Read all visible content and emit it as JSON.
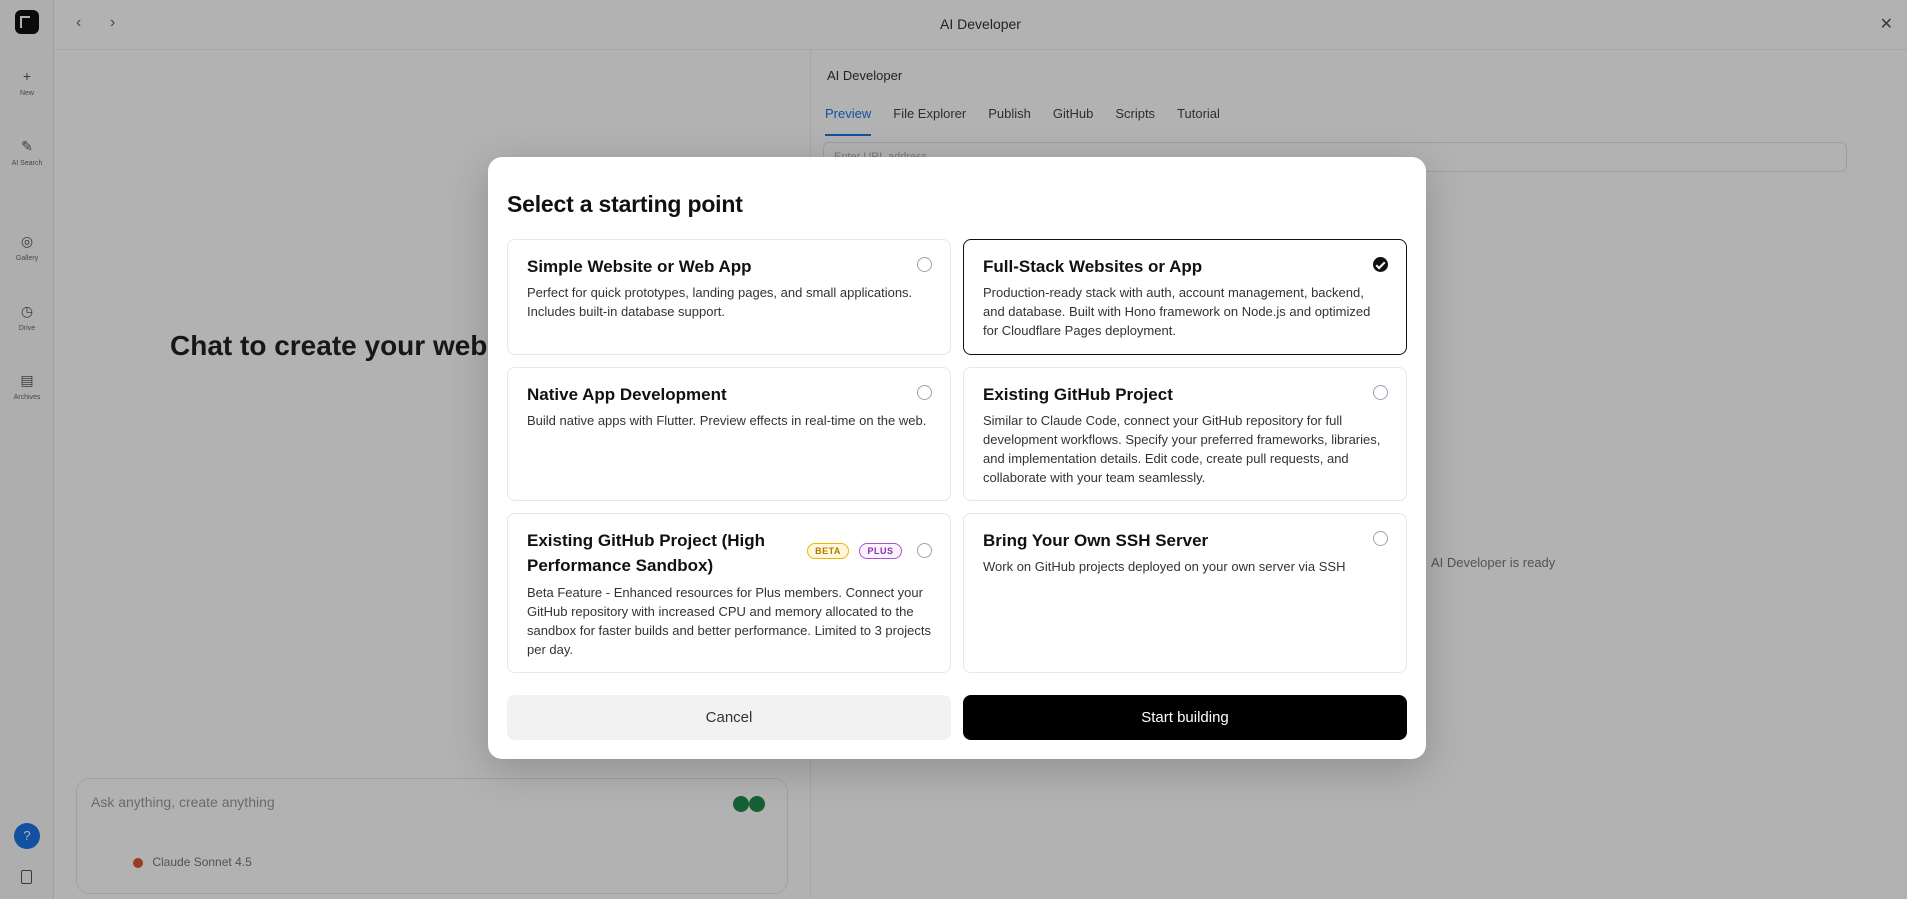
{
  "app": {
    "title": "AI Developer",
    "sidebar": [
      {
        "label": "New",
        "icon": "plus-icon"
      },
      {
        "label": "AI Search",
        "icon": "edit-icon"
      },
      {
        "label": "Gallery",
        "icon": "compass-icon"
      },
      {
        "label": "Drive",
        "icon": "clock-icon"
      },
      {
        "label": "Archives",
        "icon": "archive-icon"
      }
    ],
    "help_label": "?",
    "chat_heading": "Chat to create your website",
    "chat_placeholder": "Ask anything, create anything",
    "model_name": "Claude Sonnet 4.5",
    "panel_title": "AI Developer",
    "panel_tabs": [
      "Preview",
      "File Explorer",
      "Publish",
      "GitHub",
      "Scripts",
      "Tutorial"
    ],
    "panel_input_placeholder": "Enter URL address",
    "panel_status": "AI Developer is ready"
  },
  "modal": {
    "title": "Select a starting point",
    "options": [
      {
        "title": "Simple Website or Web App",
        "description": "Perfect for quick prototypes, landing pages, and small applications. Includes built-in database support.",
        "selected": false
      },
      {
        "title": "Full-Stack Websites or App",
        "description": "Production-ready stack with auth, account management, backend, and database. Built with Hono framework on Node.js and optimized for Cloudflare Pages deployment.",
        "selected": true
      },
      {
        "title": "Native App Development",
        "description": "Build native apps with Flutter. Preview effects in real-time on the web.",
        "selected": false
      },
      {
        "title": "Existing GitHub Project",
        "description": "Similar to Claude Code, connect your GitHub repository for full development workflows. Specify your preferred frameworks, libraries, and implementation details. Edit code, create pull requests, and collaborate with your team seamlessly.",
        "selected": false
      },
      {
        "title": "Existing GitHub Project (High Performance Sandbox)",
        "description": "Beta Feature - Enhanced resources for Plus members. Connect your GitHub repository with increased CPU and memory allocated to the sandbox for faster builds and better performance. Limited to 3 projects per day.",
        "badges": [
          "BETA",
          "PLUS"
        ],
        "selected": false
      },
      {
        "title": "Bring Your Own SSH Server",
        "description": "Work on GitHub projects deployed on your own server via SSH",
        "selected": false
      }
    ],
    "cancel_label": "Cancel",
    "start_label": "Start building"
  },
  "colors": {
    "selected_border": "#111111",
    "primary_button": "#000000",
    "beta_badge": "#f0b400",
    "plus_badge": "#a855c7"
  }
}
